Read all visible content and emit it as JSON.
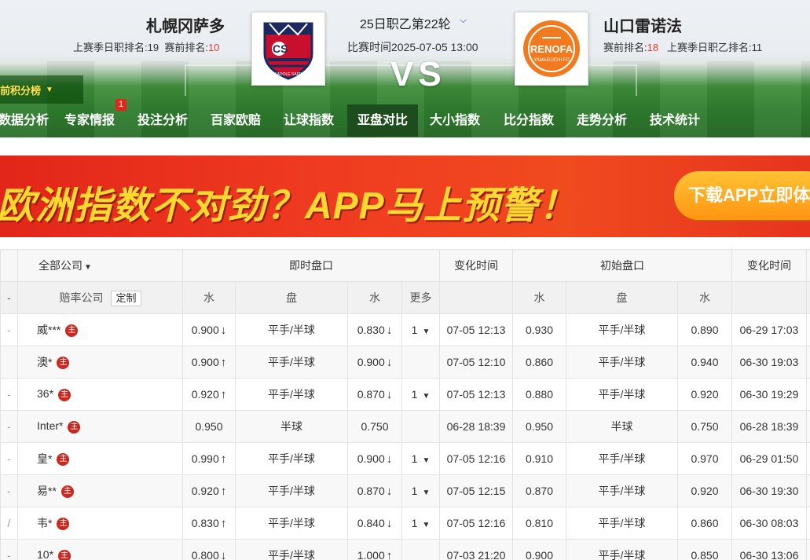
{
  "header": {
    "home": {
      "name": "札幌冈萨多",
      "last_season_label": "上赛季日职排名:",
      "last_season_rank": "19",
      "pre_label": "赛前排名:",
      "pre_rank": "10"
    },
    "away": {
      "name": "山口雷诺法",
      "pre_label": "赛前排名:",
      "pre_rank": "18",
      "last_season_label": "上赛季日职乙排名:",
      "last_season_rank": "11"
    },
    "round": "25日职乙第22轮",
    "match_time": "比赛时间2025-07-05 13:00",
    "vs": "VS",
    "standings_btn": "前积分榜",
    "logos": {
      "home_text": "CONSADOLE SAPPORO",
      "away_text": "RENOFA",
      "away_sub": "YAMAGUCHI FC"
    }
  },
  "nav": {
    "items": [
      "数据分析",
      "专家情报",
      "投注分析",
      "百家欧赔",
      "让球指数",
      "亚盘对比",
      "大小指数",
      "比分指数",
      "走势分析",
      "技术统计"
    ],
    "badge": "1"
  },
  "banner": {
    "text": "欧洲指数不对劲？APP马上预警！",
    "button": "下载APP立即体验"
  },
  "table": {
    "h1": {
      "all_company": "全部公司",
      "live": "即时盘口",
      "change_time": "变化时间",
      "initial": "初始盘口",
      "change_time2": "变化时间"
    },
    "h2": {
      "company": "赔率公司",
      "custom": "定制",
      "water": "水",
      "handicap": "盘",
      "water2": "水",
      "more": "更多",
      "water3": "水",
      "handicap2": "盘",
      "water4": "水"
    },
    "zhu": "主",
    "rows": [
      {
        "company": "威***",
        "w1": "0.900",
        "w1d": "down",
        "hc": "平手/半球",
        "w2": "0.830",
        "w2d": "down",
        "more": "1",
        "t1": "07-05 12:13",
        "iw1": "0.930",
        "ihc": "平手/半球",
        "iw2": "0.890",
        "t2": "06-29 17:03"
      },
      {
        "company": "澳*",
        "w1": "0.900",
        "w1d": "up",
        "hc": "平手/半球",
        "w2": "0.900",
        "w2d": "down",
        "more": "",
        "t1": "07-05 12:10",
        "iw1": "0.860",
        "ihc": "平手/半球",
        "iw2": "0.940",
        "t2": "06-30 19:03"
      },
      {
        "company": "36*",
        "w1": "0.920",
        "w1d": "up",
        "hc": "平手/半球",
        "w2": "0.870",
        "w2d": "down",
        "more": "1",
        "t1": "07-05 12:13",
        "iw1": "0.880",
        "ihc": "平手/半球",
        "iw2": "0.920",
        "t2": "06-30 19:29"
      },
      {
        "company": "Inter*",
        "w1": "0.950",
        "w1d": "",
        "hc": "半球",
        "w2": "0.750",
        "w2d": "",
        "more": "",
        "t1": "06-28 18:39",
        "iw1": "0.950",
        "ihc": "半球",
        "iw2": "0.750",
        "t2": "06-28 18:39"
      },
      {
        "company": "皇*",
        "w1": "0.990",
        "w1d": "up",
        "hc": "平手/半球",
        "w2": "0.900",
        "w2d": "down",
        "more": "1",
        "t1": "07-05 12:16",
        "iw1": "0.910",
        "ihc": "平手/半球",
        "iw2": "0.970",
        "t2": "06-29 01:50"
      },
      {
        "company": "易**",
        "w1": "0.920",
        "w1d": "up",
        "hc": "平手/半球",
        "w2": "0.870",
        "w2d": "down",
        "more": "1",
        "t1": "07-05 12:15",
        "iw1": "0.870",
        "ihc": "平手/半球",
        "iw2": "0.920",
        "t2": "06-30 19:30"
      },
      {
        "company": "韦*",
        "w1": "0.830",
        "w1d": "up",
        "hc": "平手/半球",
        "w2": "0.840",
        "w2d": "down",
        "more": "1",
        "t1": "07-05 12:16",
        "iw1": "0.810",
        "ihc": "平手/半球",
        "iw2": "0.860",
        "t2": "06-30 08:03"
      },
      {
        "company": "10*",
        "w1": "0.800",
        "w1d": "down",
        "hc": "平手/半球",
        "w2": "1.000",
        "w2d": "up",
        "more": "",
        "t1": "07-03 21:20",
        "iw1": "0.900",
        "ihc": "平手/半球",
        "iw2": "0.850",
        "t2": "06-30 13:06"
      }
    ]
  },
  "colors": {
    "up": "#e0302a",
    "down": "#1a9a22",
    "rank_red": "#e43c2f",
    "nav_active": "#1d4d1c"
  }
}
